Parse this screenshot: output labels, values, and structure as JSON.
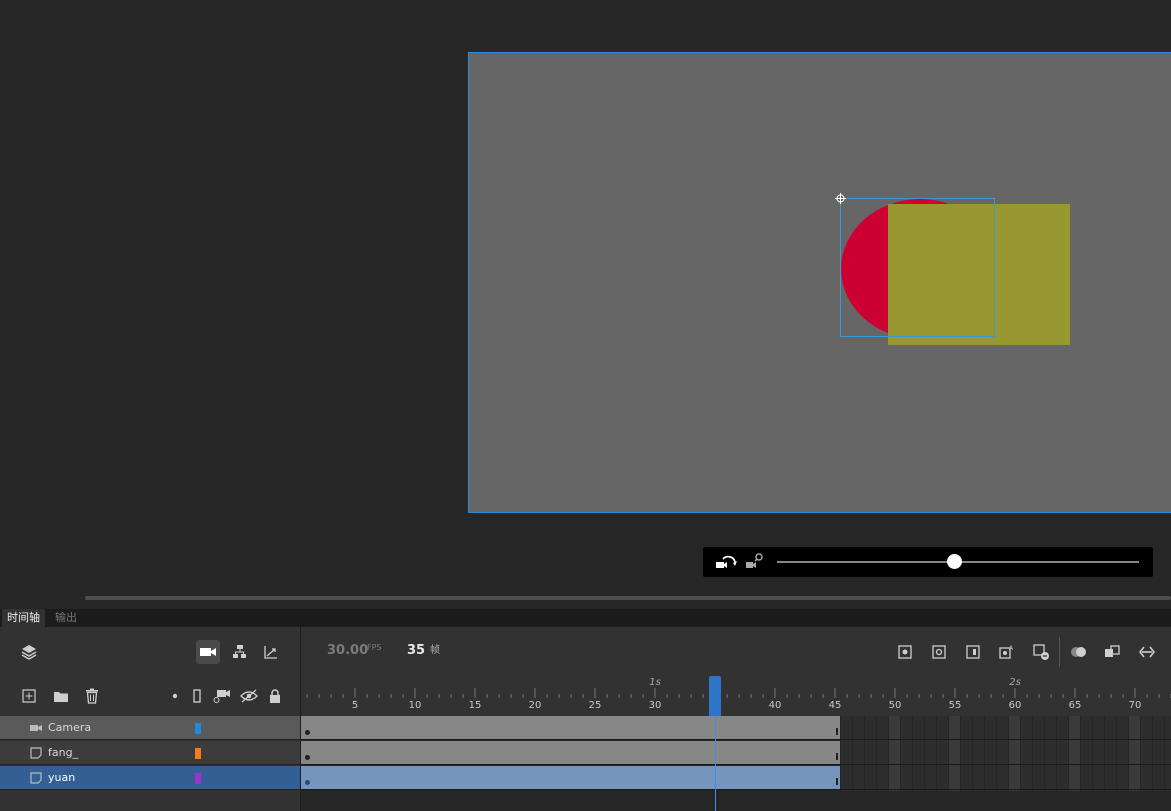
{
  "panel_tabs": [
    "时间轴",
    "输出"
  ],
  "timeline": {
    "fps": "30.00",
    "fps_unit": "FPS",
    "current_frame": "35",
    "frame_unit": "帧",
    "ruler": {
      "ticks": [
        "5",
        "10",
        "15",
        "20",
        "25",
        "30",
        "35",
        "40",
        "45",
        "50",
        "55",
        "60",
        "65",
        "70"
      ],
      "seconds": [
        "1s",
        "2s"
      ]
    },
    "layers": [
      {
        "name": "Camera",
        "type": "camera",
        "color": "#1e88e5",
        "selected": false
      },
      {
        "name": "fang_",
        "type": "layer",
        "color": "#f57c1f",
        "selected": false
      },
      {
        "name": "yuan",
        "type": "layer",
        "color": "#9b33cc",
        "selected": true
      }
    ],
    "span_end_frame": 45
  },
  "stage": {
    "background": "#666666",
    "circle_color": "#cc0033",
    "square_color": "#989833"
  },
  "camera_bar": {
    "zoom_level": 0.49
  },
  "icons": {
    "toolbar_left": [
      "layers-icon",
      "camera-icon",
      "hierarchy-icon",
      "graph-icon"
    ],
    "toolbar_right": [
      "insert-keyframe-icon",
      "insert-blank-keyframe-icon",
      "insert-frame-icon",
      "classic-tween-icon",
      "remove-frame-icon",
      "onion-skin-icon",
      "edit-multiple-frames-icon",
      "loop-icon"
    ],
    "layer_tools": [
      "new-layer-icon",
      "new-folder-icon",
      "delete-icon",
      "dot-icon",
      "outline-icon",
      "attach-camera-icon",
      "visibility-icon",
      "lock-icon"
    ]
  }
}
